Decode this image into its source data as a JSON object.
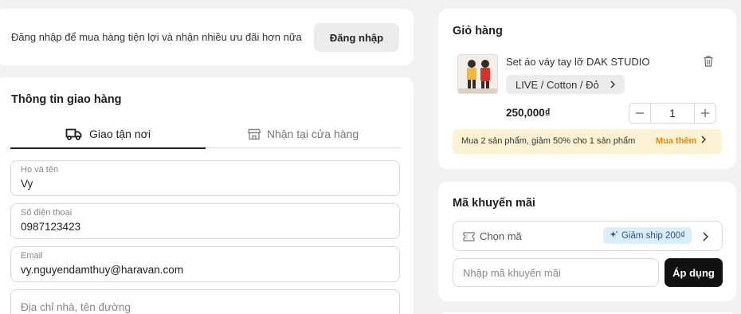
{
  "login": {
    "prompt": "Đăng nhập để mua hàng tiện lợi và nhận nhiều ưu đãi hơn nữa",
    "button": "Đăng nhập"
  },
  "shipping": {
    "title": "Thông tin giao hàng",
    "tabs": [
      {
        "label": "Giao tận nơi",
        "icon": "truck-icon",
        "active": true
      },
      {
        "label": "Nhận tại cửa hàng",
        "icon": "store-icon",
        "active": false
      }
    ],
    "fields": {
      "name": {
        "label": "Họ và tên",
        "value": "Vy"
      },
      "phone": {
        "label": "Số điện thoại",
        "value": "0987123423"
      },
      "email": {
        "label": "Email",
        "value": "vy.nguyendamthuy@haravan.com"
      },
      "address": {
        "placeholder": "Địa chỉ nhà, tên đường"
      }
    }
  },
  "cart": {
    "title": "Giỏ hàng",
    "item": {
      "name": "Set áo váy tay lỡ DAK STUDIO",
      "variant": "LIVE / Cotton / Đỏ",
      "price": "250,000₫",
      "quantity": "1"
    },
    "promo": {
      "text": "Mua 2 sản phẩm, giảm 50% cho 1 sản phẩm",
      "link": "Mua thêm"
    }
  },
  "coupon": {
    "title": "Mã khuyến mãi",
    "choose_label": "Chọn mã",
    "badge": "Giảm ship 200₫",
    "input_placeholder": "Nhập mã khuyến mãi",
    "apply_button": "Áp dụng"
  },
  "colors": {
    "accent_orange": "#e48a00",
    "promo_bg": "#fdf2d3",
    "badge_bg": "#dbeefc",
    "apply_bg": "#111111"
  }
}
